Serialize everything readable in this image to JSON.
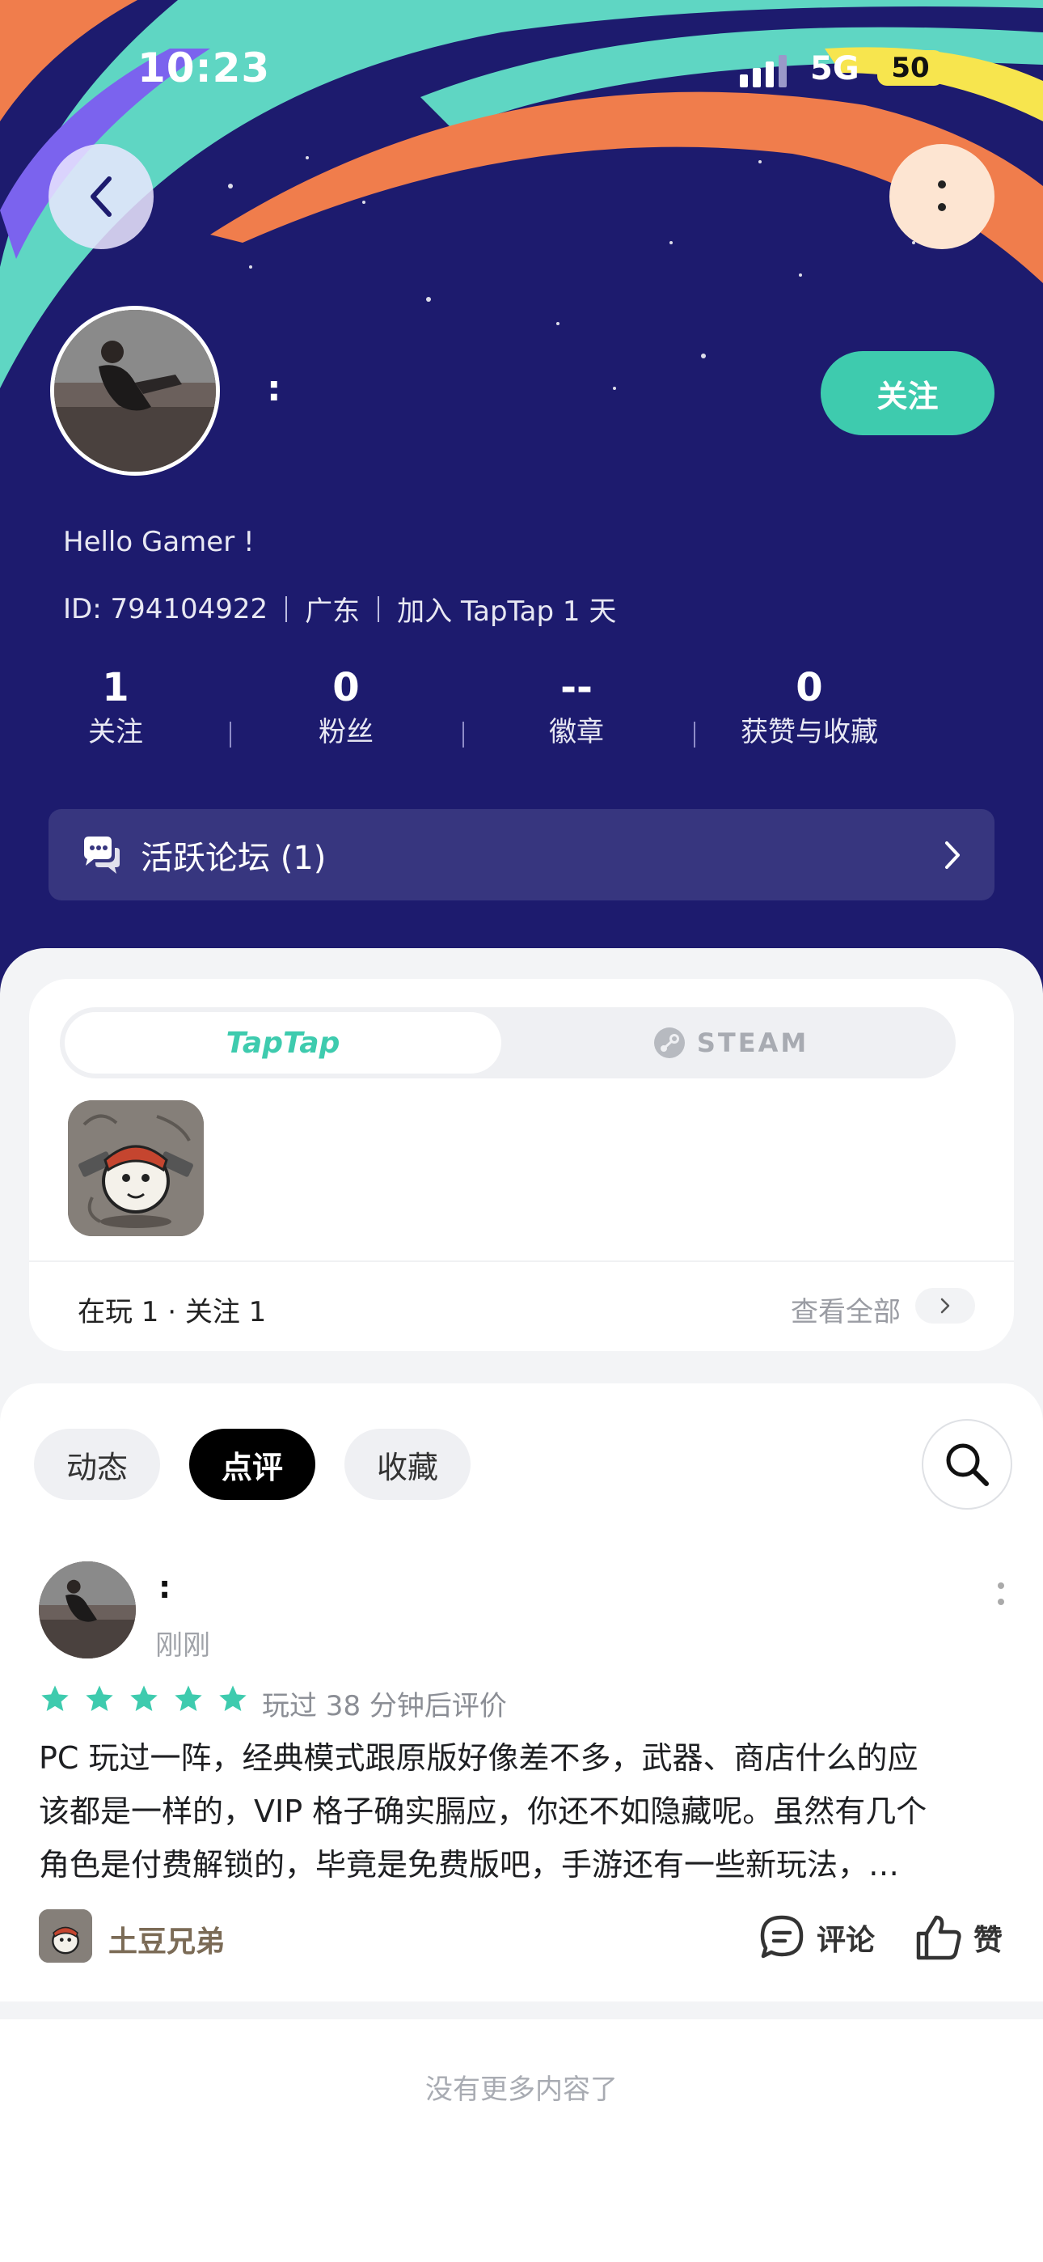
{
  "status_bar": {
    "time": "10:23",
    "network": "5G",
    "battery": "50"
  },
  "header": {
    "username": ":",
    "follow_label": "关注",
    "bio": "Hello Gamer !",
    "id_text": "ID: 794104922",
    "region": "广东",
    "joined": "加入 TapTap 1 天"
  },
  "stats": [
    {
      "value": "1",
      "label": "关注"
    },
    {
      "value": "0",
      "label": "粉丝"
    },
    {
      "value": "--",
      "label": "徽章"
    },
    {
      "value": "0",
      "label": "获赞与收藏"
    }
  ],
  "forum": {
    "label": "活跃论坛 (1)"
  },
  "games": {
    "segments": {
      "active": "TapTap",
      "inactive": "STEAM"
    },
    "playing_text": "在玩 1 · 关注 1",
    "view_all": "查看全部"
  },
  "tabs": {
    "dynamics": "动态",
    "review": "点评",
    "favorites": "收藏"
  },
  "post": {
    "username": ":",
    "time": "刚刚",
    "rating": 5,
    "played": "玩过 38 分钟后评价",
    "text_lines": [
      "PC 玩过一阵，经典模式跟原版好像差不多，武器、商店什么的应",
      "该都是一样的，VIP 格子确实膈应，你还不如隐藏呢。虽然有几个",
      "角色是付费解锁的，毕竟是免费版吧，手游还有一些新玩法，…"
    ],
    "game_name": "土豆兄弟",
    "comment_label": "评论",
    "like_label": "赞"
  },
  "footer": {
    "no_more": "没有更多内容了"
  },
  "colors": {
    "header_bg": "#1d1b6e",
    "accent": "#3ecbae",
    "star": "#3ecbae"
  }
}
